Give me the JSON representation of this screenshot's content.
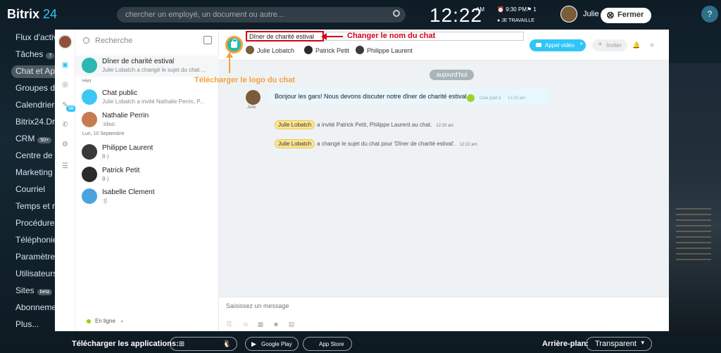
{
  "portal": {
    "logo_text": "Bitrix",
    "logo_num": "24",
    "search_placeholder": "chercher un employé, un document ou autre...",
    "clock": "12:22",
    "ampm": "AM",
    "alarm_time": "9:30 PM",
    "flag_count": "1",
    "work_status": "JE TRAVAILLE",
    "user_name": "Julie Lob",
    "close_label": "Fermer",
    "help_label": "?"
  },
  "leftnav": {
    "items": [
      {
        "label": "Flux d'activ",
        "count": ""
      },
      {
        "label": "Tâches",
        "count": "7"
      },
      {
        "label": "Chat et App",
        "count": ""
      },
      {
        "label": "Groupes de",
        "count": ""
      },
      {
        "label": "Calendrier",
        "count": ""
      },
      {
        "label": "Bitrix24.Driv",
        "count": ""
      },
      {
        "label": "CRM",
        "count": "50+"
      },
      {
        "label": "Centre de c",
        "count": ""
      },
      {
        "label": "Marketing C",
        "count": ""
      },
      {
        "label": "Courriel",
        "count": ""
      },
      {
        "label": "Temps et ra",
        "count": ""
      },
      {
        "label": "Procédure d",
        "count": ""
      },
      {
        "label": "Téléphonie",
        "count": ""
      },
      {
        "label": "Paramètres",
        "count": ""
      },
      {
        "label": "Utilisateurs",
        "count": ""
      },
      {
        "label": "Sites",
        "count": "beta"
      },
      {
        "label": "Abonneme",
        "count": ""
      },
      {
        "label": "Plus...",
        "count": ""
      }
    ]
  },
  "bottom": {
    "download_label": "Télécharger les applications:",
    "google_play": "Google Play",
    "app_store": "App Store",
    "background_label": "Arrière-plan:",
    "background_value": "Transparent"
  },
  "sidebar": {
    "badge": "38"
  },
  "recent": {
    "search_placeholder": "Recherche",
    "items": [
      {
        "name": "Dîner de charité estival",
        "last": "Julie Lobatch a changé le sujet du chat ...",
        "color": "#2bb8b0"
      },
      {
        "section": "Hier"
      },
      {
        "name": "Chat public",
        "last": "Julie Lobatch a invité Nathalie Perrin, P...",
        "color": "#3bc8f5"
      },
      {
        "name": "Nathalie Perrin",
        "last": ":idea:",
        "color": "#c77b52"
      },
      {
        "section": "Lun, 10 Septembre"
      },
      {
        "name": "Philippe Laurent",
        "last": "8-)",
        "color": "#3a3a3a"
      },
      {
        "name": "Patrick Petit",
        "last": "8-)",
        "color": "#2b2b2b"
      },
      {
        "name": "Isabelle Clement",
        "last": ":(|",
        "color": "#4aa3df"
      }
    ],
    "status": "En ligne"
  },
  "chat": {
    "title_value": "Dîner de charité estival",
    "members": [
      "Julie Lobatch",
      "Patrick Petit",
      "Philippe Laurent"
    ],
    "call_label": "Appel vidéo",
    "invite_label": "Inviter",
    "day_separator": "aujourd'hui",
    "message": {
      "author_short": "Julie",
      "text": "Bonjour les gars! Nous devons discuter notre dîner de charité estival",
      "likes": "Cela plaît à",
      "time": "12:20 am"
    },
    "system": [
      {
        "name": "Julie Lobatch",
        "text": "a invité Patrick Petit, Philippe Laurent au chat.",
        "time": "12:20 am"
      },
      {
        "name": "Julie Lobatch",
        "text": "a changé le sujet du chat pour 'Dîner de charité estival'.",
        "time": "12:22 am"
      }
    ],
    "composer_placeholder": "Saisissez un message"
  },
  "annotations": {
    "rename": "Changer le nom du chat",
    "logo": "Télécharger le logo du chat",
    "colors": {
      "red": "#d0021b",
      "orange": "#f0a23b"
    }
  },
  "colors": {
    "accent": "#2fc6f6",
    "chat_logo": "#2bb8b0"
  }
}
